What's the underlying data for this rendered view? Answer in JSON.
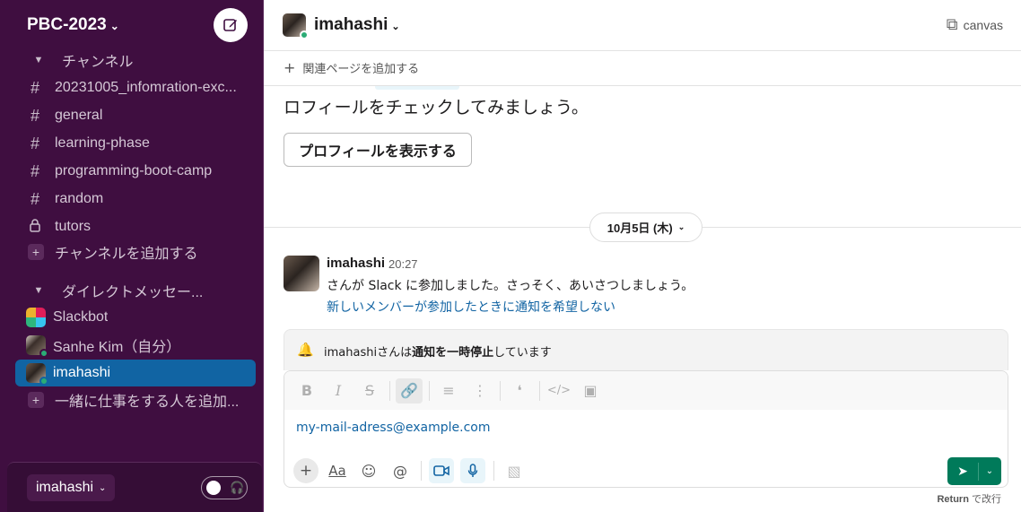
{
  "workspace": {
    "name": "PBC-2023"
  },
  "sidebar": {
    "channels_header": "チャンネル",
    "channels": [
      {
        "label": "20231005_infomration-exc..."
      },
      {
        "label": "general"
      },
      {
        "label": "learning-phase"
      },
      {
        "label": "programming-boot-camp"
      },
      {
        "label": "random"
      },
      {
        "label": "tutors"
      }
    ],
    "add_channel": "チャンネルを追加する",
    "dm_header": "ダイレクトメッセー...",
    "dms": [
      {
        "label": "Slackbot"
      },
      {
        "label": "Sanhe Kim（自分）"
      },
      {
        "label": "imahashi"
      }
    ],
    "add_people": "一緒に仕事をする人を追加...",
    "footer": {
      "user": "imahashi"
    }
  },
  "header": {
    "channel_name": "imahashi",
    "canvas_label": "canvas",
    "bookmark_add": "関連ページを追加する"
  },
  "messages": {
    "profile_text": "ロフィールをチェックしてみましょう。",
    "profile_button": "プロフィールを表示する",
    "date_label": "10月5日 (木)",
    "author": "imahashi",
    "time": "20:27",
    "body": "さんが Slack に参加しました。さっそく、あいさつしましょう。",
    "link": "新しいメンバーが参加したときに通知を希望しない"
  },
  "composer": {
    "dnd_prefix": "imahashiさんは",
    "dnd_bold": "通知を一時停止",
    "dnd_suffix": "しています",
    "input_value": "my-mail-adress@example.com",
    "aa_label": "Aa",
    "hint_key": "Return",
    "hint_text": " で改行"
  },
  "colors": {
    "sidebar_bg": "#3f0e40",
    "active": "#1164a3",
    "send": "#007a5a",
    "link": "#1264a3"
  }
}
